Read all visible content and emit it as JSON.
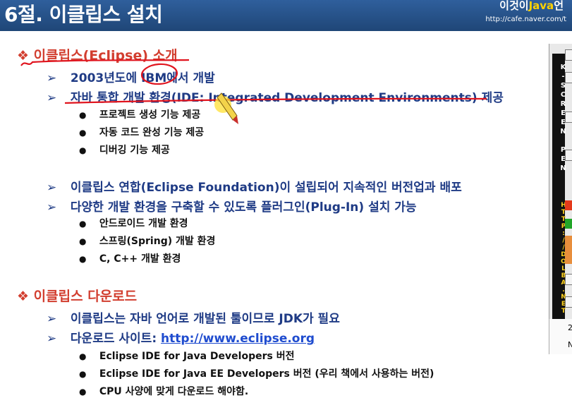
{
  "header": {
    "title": "6절. 이클립스 설치",
    "brand_prefix": "이것이",
    "brand_java": "Java",
    "brand_suffix": "언",
    "url": "http://cafe.naver.com/t"
  },
  "panel": {
    "letters": "K-SCREEN PEN",
    "url": "HTTP://DOLBA.NET",
    "bottom_a": "2",
    "bottom_b": "N"
  },
  "symbols": {
    "diamond": "❖",
    "arrow": "➢",
    "dot": "●"
  },
  "sections": [
    {
      "heading": "이클립스(Eclipse) 소개",
      "items": [
        {
          "text": "2003년도에 IBM에서 개발"
        },
        {
          "text": "자바 통합 개발 환경(IDE: Integrated Development Environments) 제공",
          "bullets": [
            "프로젝트 생성 기능 제공",
            "자동 코드 완성 기능 제공",
            "디버깅 기능 제공"
          ]
        },
        {
          "text": "이클립스 연합(Eclipse Foundation)이 설립되어 지속적인 버전업과 배포"
        },
        {
          "text": "다양한 개발 환경을 구축할 수 있도록 플러그인(Plug-In) 설치 가능",
          "bullets": [
            "안드로이드 개발 환경",
            "스프링(Spring) 개발 환경",
            "C, C++ 개발 환경"
          ]
        }
      ]
    },
    {
      "heading": "이클립스 다운로드",
      "items": [
        {
          "text": "이클립스는 자바 언어로 개발된 툴이므로 JDK가 필요"
        },
        {
          "text": "다운로드 사이트:",
          "link": "http://www.eclipse.org",
          "bullets": [
            "Eclipse IDE for Java Developers 버전",
            "Eclipse IDE for Java EE Developers 버전 (우리 책에서 사용하는 버전)",
            "CPU 사양에 맞게 다운로드 해야함."
          ]
        }
      ]
    }
  ],
  "colors": {
    "header": "#2a5793",
    "heading": "#d23e2f",
    "sub": "#1f3b85",
    "ink": "#e0141e",
    "link": "#1f4ccf"
  }
}
